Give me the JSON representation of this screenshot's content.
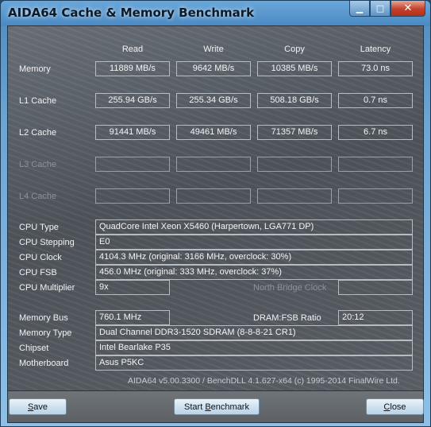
{
  "window": {
    "title": "AIDA64 Cache & Memory Benchmark",
    "minimize_icon": "minimize-icon",
    "maximize_icon": "maximize-icon",
    "close_icon": "close-icon",
    "minimize_glyph": "▁",
    "maximize_glyph": "□",
    "close_glyph": "✕"
  },
  "columns": {
    "read": "Read",
    "write": "Write",
    "copy": "Copy",
    "latency": "Latency"
  },
  "rows": {
    "memory": {
      "label": "Memory",
      "read": "11889 MB/s",
      "write": "9642 MB/s",
      "copy": "10385 MB/s",
      "latency": "73.0 ns"
    },
    "l1": {
      "label": "L1 Cache",
      "read": "255.94 GB/s",
      "write": "255.34 GB/s",
      "copy": "508.18 GB/s",
      "latency": "0.7 ns"
    },
    "l2": {
      "label": "L2 Cache",
      "read": "91441 MB/s",
      "write": "49461 MB/s",
      "copy": "71357 MB/s",
      "latency": "6.7 ns"
    },
    "l3": {
      "label": "L3 Cache",
      "read": "",
      "write": "",
      "copy": "",
      "latency": ""
    },
    "l4": {
      "label": "L4 Cache",
      "read": "",
      "write": "",
      "copy": "",
      "latency": ""
    }
  },
  "cpu": {
    "type_label": "CPU Type",
    "type": "QuadCore Intel Xeon X5460  (Harpertown, LGA771 DP)",
    "stepping_label": "CPU Stepping",
    "stepping": "E0",
    "clock_label": "CPU Clock",
    "clock": "4104.3 MHz  (original: 3166 MHz, overclock: 30%)",
    "fsb_label": "CPU FSB",
    "fsb": "456.0 MHz  (original: 333 MHz, overclock: 37%)",
    "multiplier_label": "CPU Multiplier",
    "multiplier": "9x",
    "nb_clock_label": "North Bridge Clock",
    "nb_clock": ""
  },
  "memory": {
    "bus_label": "Memory Bus",
    "bus": "760.1 MHz",
    "ratio_label": "DRAM:FSB Ratio",
    "ratio": "20:12",
    "type_label": "Memory Type",
    "type": "Dual Channel DDR3-1520 SDRAM  (8-8-8-21 CR1)",
    "chipset_label": "Chipset",
    "chipset": "Intel Bearlake P35",
    "motherboard_label": "Motherboard",
    "motherboard": "Asus P5KC"
  },
  "version_text": "AIDA64 v5.00.3300 / BenchDLL 4.1.627-x64  (c) 1995-2014 FinalWire Ltd.",
  "buttons": {
    "save_hot": "S",
    "save_rest": "ave",
    "start_pre": "Start ",
    "start_hot": "B",
    "start_rest": "enchmark",
    "close_hot": "C",
    "close_rest": "lose"
  }
}
